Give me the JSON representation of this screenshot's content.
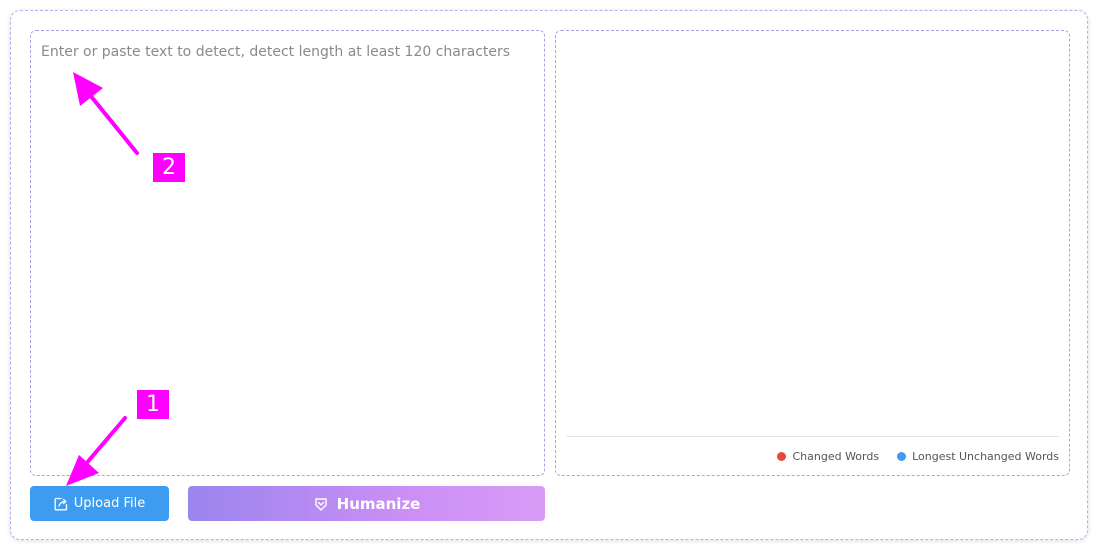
{
  "input": {
    "placeholder": "Enter or paste text to detect, detect length at least 120 characters",
    "value": ""
  },
  "output": {
    "legend": [
      {
        "label": "Changed Words",
        "color": "#e8483b"
      },
      {
        "label": "Longest Unchanged Words",
        "color": "#3d9cf0"
      }
    ]
  },
  "actions": {
    "upload_label": "Upload File",
    "upload_icon": "upload-icon",
    "humanize_label": "Humanize",
    "humanize_icon": "humanize-icon"
  },
  "annotations": [
    {
      "label": "1",
      "color": "#ff00ff"
    },
    {
      "label": "2",
      "color": "#ff00ff"
    }
  ]
}
